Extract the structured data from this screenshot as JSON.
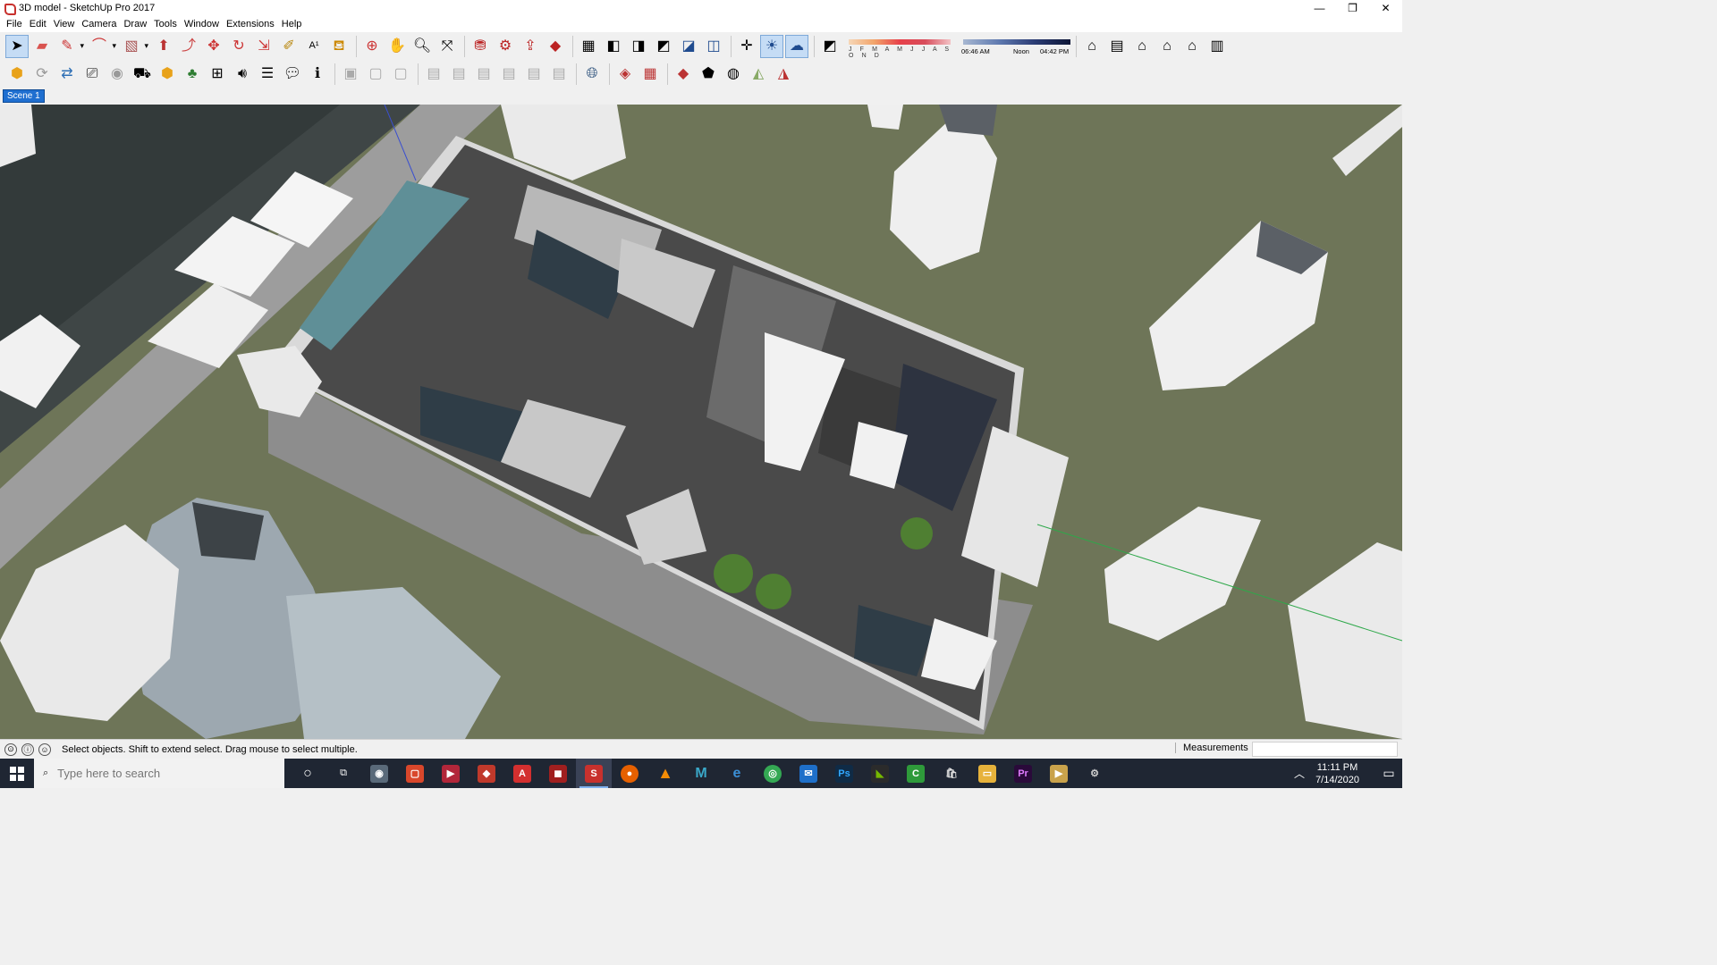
{
  "window": {
    "title": "3D model - SketchUp Pro 2017",
    "controls": [
      "—",
      "❐",
      "✕"
    ]
  },
  "menu": [
    "File",
    "Edit",
    "View",
    "Camera",
    "Draw",
    "Tools",
    "Window",
    "Extensions",
    "Help"
  ],
  "toolbar": {
    "shadow_months": "J F M A M J J A S O N D",
    "time_start": "06:46 AM",
    "time_noon": "Noon",
    "time_end": "04:42 PM"
  },
  "scenes": [
    "Scene 1"
  ],
  "status": {
    "message": "Select objects. Shift to extend select. Drag mouse to select multiple.",
    "measurements_label": "Measurements",
    "measurements_value": ""
  },
  "taskbar": {
    "search_placeholder": "Type here to search",
    "time": "11:11 PM",
    "date": "7/14/2020"
  }
}
